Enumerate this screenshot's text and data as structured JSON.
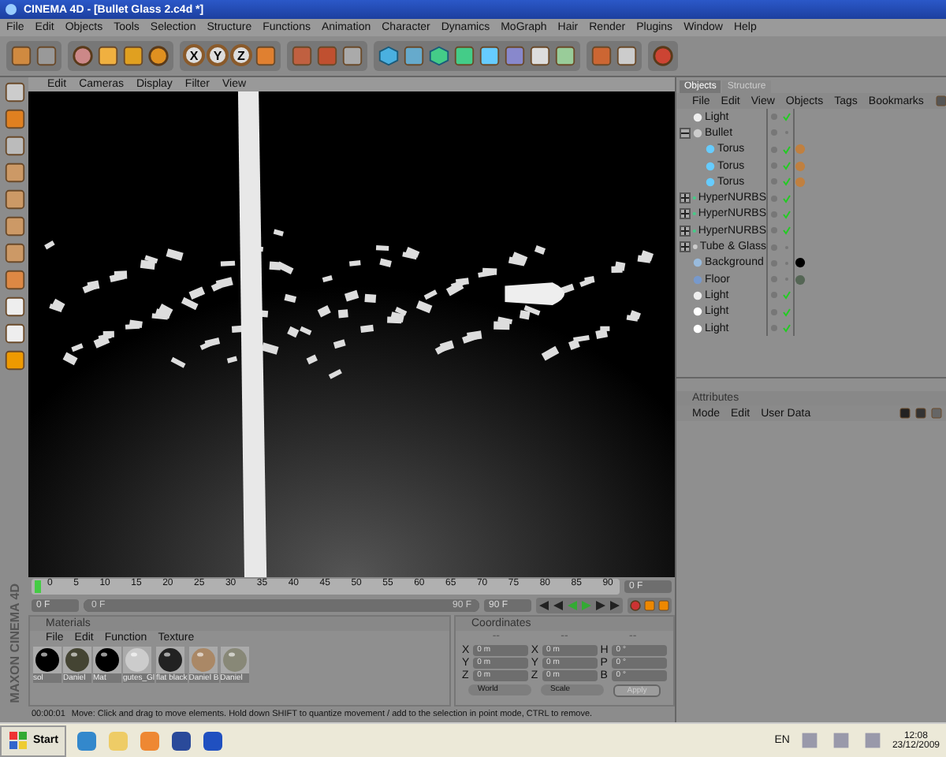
{
  "window": {
    "title": "CINEMA 4D - [Bullet Glass 2.c4d *]"
  },
  "menu": [
    "File",
    "Edit",
    "Objects",
    "Tools",
    "Selection",
    "Structure",
    "Functions",
    "Animation",
    "Character",
    "Dynamics",
    "MoGraph",
    "Hair",
    "Render",
    "Plugins",
    "Window",
    "Help"
  ],
  "axis_buttons": [
    "X",
    "Y",
    "Z"
  ],
  "viewport": {
    "menu": [
      "Edit",
      "Cameras",
      "Display",
      "Filter",
      "View"
    ]
  },
  "objects_panel": {
    "tabs": [
      {
        "label": "Objects",
        "selected": true
      },
      {
        "label": "Structure",
        "selected": false
      }
    ],
    "menu": [
      "File",
      "Edit",
      "View",
      "Objects",
      "Tags",
      "Bookmarks"
    ],
    "tree": [
      {
        "name": "Light",
        "kind": "spot",
        "checked": true
      },
      {
        "name": "Bullet",
        "kind": "null",
        "checked": false,
        "expanded": true,
        "children": [
          {
            "name": "Torus",
            "kind": "torus",
            "checked": true,
            "tags": [
              {
                "color": "#c08040"
              }
            ]
          },
          {
            "name": "Torus",
            "kind": "torus",
            "checked": true,
            "tags": [
              {
                "color": "#c08040"
              }
            ]
          },
          {
            "name": "Torus",
            "kind": "torus",
            "checked": true,
            "tags": [
              {
                "color": "#c08040"
              }
            ]
          }
        ]
      },
      {
        "name": "HyperNURBS",
        "kind": "nurbs",
        "checked": true,
        "expanded": false
      },
      {
        "name": "HyperNURBS",
        "kind": "nurbs",
        "checked": true,
        "expanded": false
      },
      {
        "name": "HyperNURBS",
        "kind": "nurbs",
        "checked": true,
        "expanded": false
      },
      {
        "name": "Tube & Glass",
        "kind": "null",
        "checked": false,
        "expanded": false
      },
      {
        "name": "Background",
        "kind": "background",
        "checked": false,
        "tags": [
          {
            "color": "#000000"
          }
        ]
      },
      {
        "name": "Floor",
        "kind": "floor",
        "checked": false,
        "tags": [
          {
            "color": "#556655"
          }
        ]
      },
      {
        "name": "Light",
        "kind": "spot",
        "checked": true
      },
      {
        "name": "Light",
        "kind": "omni",
        "checked": true
      },
      {
        "name": "Light",
        "kind": "omni",
        "checked": true
      }
    ]
  },
  "attributes": {
    "title": "Attributes",
    "menu": [
      "Mode",
      "Edit",
      "User Data"
    ]
  },
  "timeline": {
    "ticks": [
      "0",
      "5",
      "10",
      "15",
      "20",
      "25",
      "30",
      "35",
      "40",
      "45",
      "50",
      "55",
      "60",
      "65",
      "70",
      "75",
      "80",
      "85",
      "90"
    ],
    "current": "0 F",
    "start": "0 F",
    "range": {
      "start": "0 F",
      "end": "90 F",
      "level": 1
    },
    "end": "90 F"
  },
  "materials": {
    "title": "Materials",
    "menu": [
      "File",
      "Edit",
      "Function",
      "Texture"
    ],
    "items": [
      {
        "name": "sol",
        "kind": "black"
      },
      {
        "name": "Daniel",
        "kind": "stripe"
      },
      {
        "name": "Mat",
        "kind": "black"
      },
      {
        "name": "gutes_Gl",
        "kind": "glass"
      },
      {
        "name": "flat black",
        "kind": "dark"
      },
      {
        "name": "Daniel B",
        "kind": "gold"
      },
      {
        "name": "Daniel",
        "kind": "metal"
      }
    ]
  },
  "coordinates": {
    "title": "Coordinates",
    "headers": [
      "--",
      "--",
      "--"
    ],
    "rows": [
      {
        "a": "X",
        "a_value": "0 m",
        "b": "X",
        "b_value": "0 m",
        "c": "H",
        "c_value": "0 °"
      },
      {
        "a": "Y",
        "a_value": "0 m",
        "b": "Y",
        "b_value": "0 m",
        "c": "P",
        "c_value": "0 °"
      },
      {
        "a": "Z",
        "a_value": "0 m",
        "b": "Z",
        "b_value": "0 m",
        "c": "B",
        "c_value": "0 °"
      }
    ],
    "mode_1": "World",
    "mode_2": "Scale",
    "apply": "Apply"
  },
  "logo": "MAXON CINEMA 4D",
  "status_bar": {
    "time": "00:00:01",
    "message": "Move: Click and drag to move elements. Hold down SHIFT to quantize movement / add to the selection in point mode, CTRL to remove."
  },
  "taskbar": {
    "start": "Start",
    "language": "EN",
    "time": "12:08",
    "date": "23/12/2009"
  }
}
